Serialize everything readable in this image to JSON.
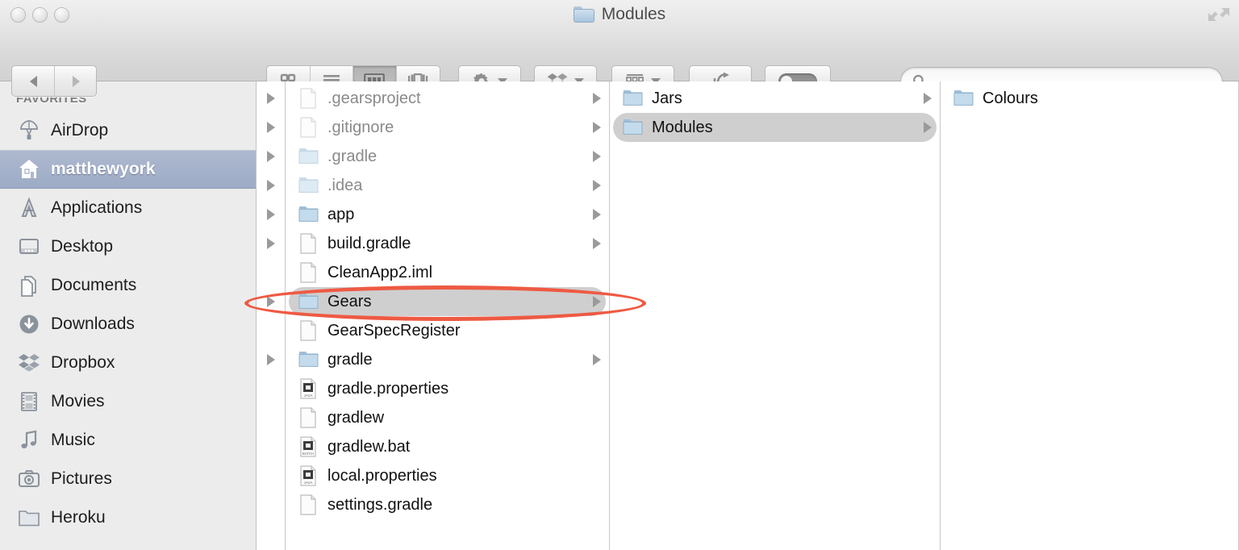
{
  "window": {
    "title": "Modules",
    "title_icon": "folder-icon",
    "traffic_lights": [
      "close-button",
      "minimize-button",
      "zoom-button"
    ],
    "fullscreen_icon": "fullscreen-expand-icon"
  },
  "toolbar": {
    "nav": {
      "back_label": "Back",
      "back_icon": "chevron-left-icon",
      "forward_label": "Forward",
      "forward_icon": "chevron-right-icon"
    },
    "view_modes": [
      {
        "id": "icon-view",
        "label": "as Icons",
        "icon": "grid-icon",
        "active": false
      },
      {
        "id": "list-view",
        "label": "as List",
        "icon": "list-icon",
        "active": false
      },
      {
        "id": "column-view",
        "label": "as Columns",
        "icon": "columns-icon",
        "active": true
      },
      {
        "id": "flow-view",
        "label": "Cover Flow",
        "icon": "coverflow-icon",
        "active": false
      }
    ],
    "action_menu": {
      "label": "Action",
      "icon": "gear-icon",
      "has_dropdown": true
    },
    "dropbox_menu": {
      "label": "Dropbox",
      "icon": "dropbox-icon",
      "has_dropdown": true
    },
    "arrange_menu": {
      "label": "Arrange",
      "icon": "arrange-grid-icon",
      "has_dropdown": true
    },
    "share_button": {
      "label": "Share",
      "icon": "share-icon"
    },
    "tags_button": {
      "label": "Tags",
      "icon": "toggle-switch-icon",
      "state": "off"
    },
    "search": {
      "value": "",
      "placeholder": "",
      "icon": "search-icon"
    }
  },
  "sidebar": {
    "sections": [
      {
        "header": "FAVORITES",
        "items": [
          {
            "label": "AirDrop",
            "icon": "airdrop-icon",
            "selected": false
          },
          {
            "label": "matthewyork",
            "icon": "home-icon",
            "selected": true
          },
          {
            "label": "Applications",
            "icon": "applications-icon",
            "selected": false
          },
          {
            "label": "Desktop",
            "icon": "desktop-icon",
            "selected": false
          },
          {
            "label": "Documents",
            "icon": "documents-icon",
            "selected": false
          },
          {
            "label": "Downloads",
            "icon": "downloads-icon",
            "selected": false
          },
          {
            "label": "Dropbox",
            "icon": "dropbox-icon",
            "selected": false
          },
          {
            "label": "Movies",
            "icon": "movies-icon",
            "selected": false
          },
          {
            "label": "Music",
            "icon": "music-icon",
            "selected": false
          },
          {
            "label": "Pictures",
            "icon": "pictures-icon",
            "selected": false
          },
          {
            "label": "Heroku",
            "icon": "folder-gray-icon",
            "selected": false
          }
        ]
      }
    ]
  },
  "columns": [
    {
      "id": "column-files",
      "items": [
        {
          "label": ".gearsproject",
          "icon": "document-icon",
          "dimmed": true,
          "expandable": true,
          "selected": false
        },
        {
          "label": ".gitignore",
          "icon": "document-icon",
          "dimmed": true,
          "expandable": true,
          "selected": false
        },
        {
          "label": ".gradle",
          "icon": "folder-blue-icon",
          "dimmed": true,
          "expandable": true,
          "selected": false
        },
        {
          "label": ".idea",
          "icon": "folder-blue-icon",
          "dimmed": true,
          "expandable": true,
          "selected": false
        },
        {
          "label": "app",
          "icon": "folder-blue-icon",
          "dimmed": false,
          "expandable": true,
          "selected": false
        },
        {
          "label": "build.gradle",
          "icon": "document-icon",
          "dimmed": false,
          "expandable": true,
          "selected": false
        },
        {
          "label": "CleanApp2.iml",
          "icon": "document-icon",
          "dimmed": false,
          "expandable": false,
          "selected": false
        },
        {
          "label": "Gears",
          "icon": "folder-blue-icon",
          "dimmed": false,
          "expandable": true,
          "selected": true
        },
        {
          "label": "GearSpecRegister",
          "icon": "document-icon",
          "dimmed": false,
          "expandable": false,
          "selected": false
        },
        {
          "label": "gradle",
          "icon": "folder-blue-icon",
          "dimmed": false,
          "expandable": true,
          "selected": false
        },
        {
          "label": "gradle.properties",
          "icon": "java-document-icon",
          "dimmed": false,
          "expandable": false,
          "selected": false
        },
        {
          "label": "gradlew",
          "icon": "document-icon",
          "dimmed": false,
          "expandable": false,
          "selected": false
        },
        {
          "label": "gradlew.bat",
          "icon": "batch-document-icon",
          "dimmed": false,
          "expandable": false,
          "selected": false
        },
        {
          "label": "local.properties",
          "icon": "java-document-icon",
          "dimmed": false,
          "expandable": false,
          "selected": false
        },
        {
          "label": "settings.gradle",
          "icon": "document-icon",
          "dimmed": false,
          "expandable": false,
          "selected": false
        }
      ]
    },
    {
      "id": "column-subfolders",
      "items": [
        {
          "label": "Jars",
          "icon": "folder-blue-icon",
          "dimmed": false,
          "expandable": true,
          "selected": false
        },
        {
          "label": "Modules",
          "icon": "folder-blue-icon",
          "dimmed": false,
          "expandable": true,
          "selected": true
        }
      ]
    },
    {
      "id": "column-leaf",
      "items": [
        {
          "label": "Colours",
          "icon": "folder-blue-icon",
          "dimmed": false,
          "expandable": false,
          "selected": false
        }
      ]
    }
  ],
  "annotation": {
    "shape": "ellipse",
    "color": "#ee5a43",
    "targets": "Gears"
  }
}
